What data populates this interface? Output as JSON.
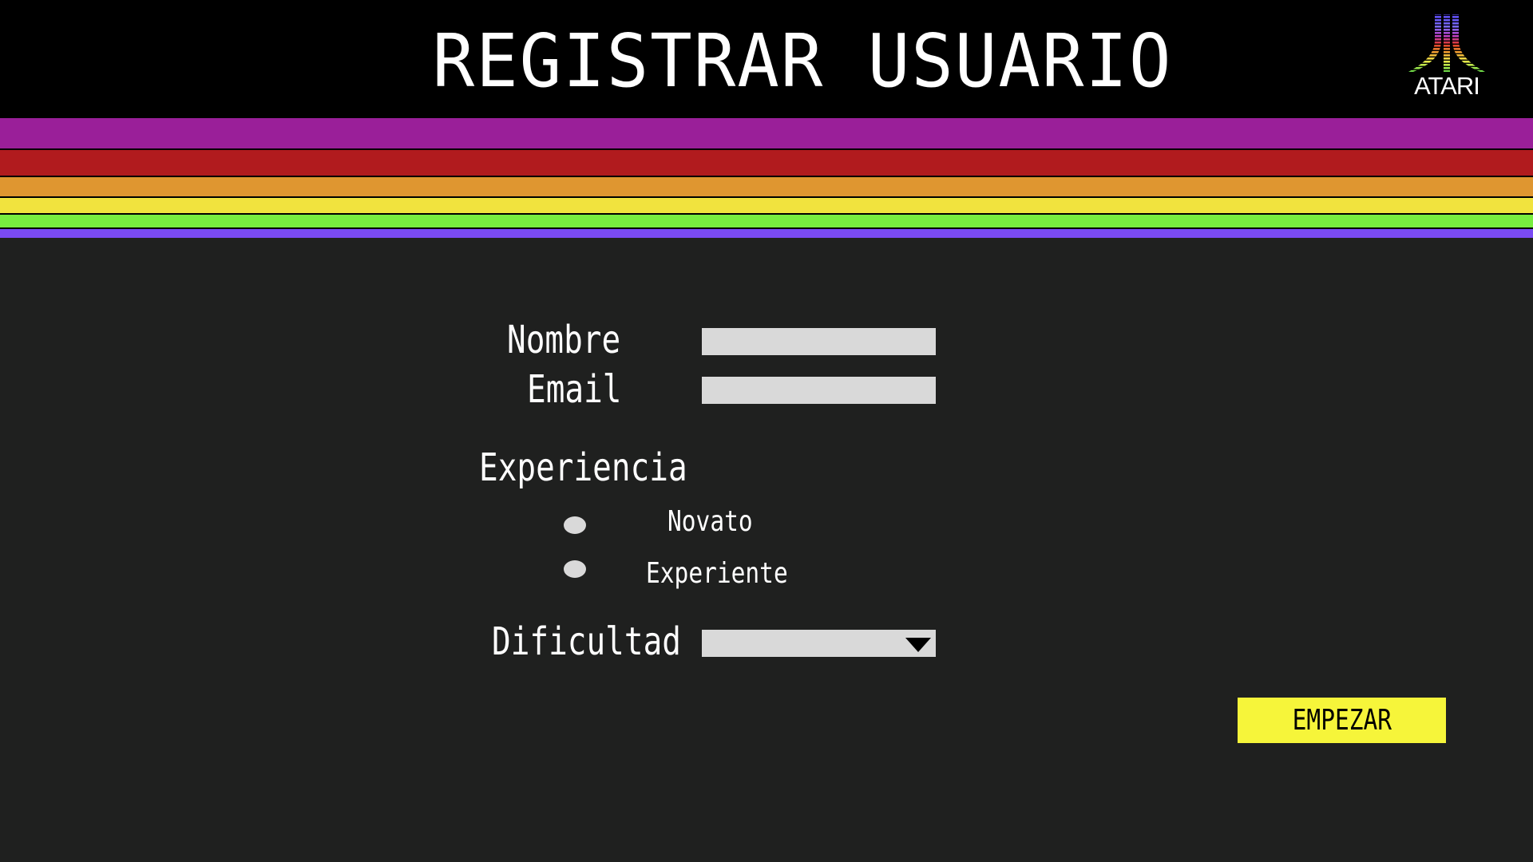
{
  "header": {
    "title": "REGISTRAR USUARIO",
    "logo_text": "ATARI",
    "logo_icon": "atari-fuji-logo",
    "background": "#000000"
  },
  "stripes": [
    {
      "color": "#9a1f99"
    },
    {
      "color": "#b11b1e"
    },
    {
      "color": "#df9630"
    },
    {
      "color": "#f1e33e"
    },
    {
      "color": "#78ed3f"
    },
    {
      "color": "#7a4af3"
    }
  ],
  "form": {
    "name_label": "Nombre",
    "name_value": "",
    "email_label": "Email",
    "email_value": "",
    "experience_label": "Experiencia",
    "options": [
      {
        "label": "Novato",
        "selected": false
      },
      {
        "label": "Experiente",
        "selected": false
      }
    ],
    "difficulty_label": "Dificultad",
    "difficulty_value": "",
    "submit_label": "EMPEZAR"
  },
  "colors": {
    "background": "#1f201f",
    "field": "#d9d9d9",
    "button": "#f6f53a",
    "text": "#ffffff"
  }
}
